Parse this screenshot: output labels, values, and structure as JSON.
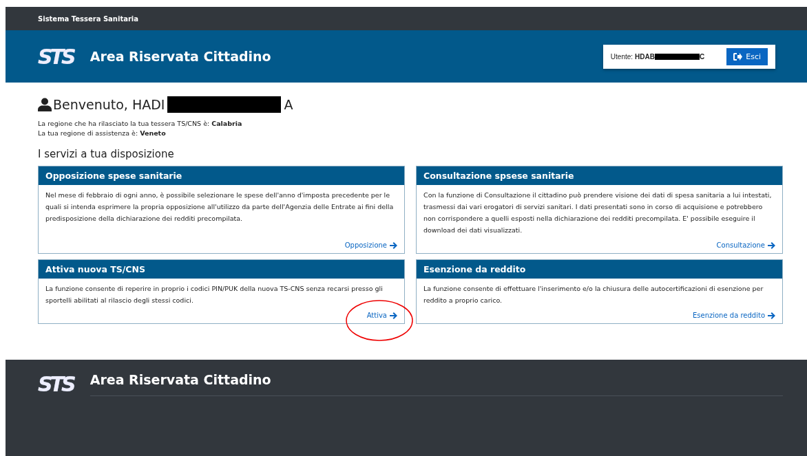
{
  "top_bar": {
    "title": "Sistema Tessera Sanitaria"
  },
  "header": {
    "logo": "STS",
    "title": "Area Riservata Cittadino",
    "user_label": "Utente:",
    "user_code_start": "HDAB",
    "user_code_end": "C",
    "logout": "Esci"
  },
  "welcome": {
    "greeting": "Benvenuto, HADI",
    "name_end": "A",
    "lines": [
      "La regione che ha rilasciato la tua tessera TS/CNS è:  **Calabria**",
      "La tua regione di assistenza è:  **Veneto**"
    ]
  },
  "services": {
    "title": "I servizi a tua disposizione",
    "cards": [
      {
        "title": "Opposizione spese sanitarie",
        "text": "Nel mese di febbraio di ogni anno, è possibile selezionare le spese dell'anno d'imposta precedente per le quali si intenda esprimere la propria opposizione all'utilizzo da parte dell'Agenzia delle Entrate ai fini della predisposizione della dichiarazione dei redditi precompilata.",
        "link": "Opposizione",
        "circled": false
      },
      {
        "title": "Consultazione spsese sanitarie",
        "text": "Con la funzione di Consultazione il cittadino può prendere visione dei dati di spesa sanitaria a lui intestati, trasmessi dai vari erogatori di servizi sanitari. I dati presentati sono in corso di acquisione e potrebbero non corrispondere a quelli esposti nella dichiarazione dei redditi precompilata. E' possibile eseguire il download dei dati visualizzati.",
        "link": "Consultazione",
        "circled": false
      },
      {
        "title": "Attiva nuova TS/CNS",
        "text": "La funzione consente di reperire in proprio i codici PIN/PUK della nuova TS-CNS senza recarsi presso gli sportelli abilitati al rilascio degli stessi codici.",
        "link": "Attiva",
        "circled": true
      },
      {
        "title": "Esenzione da reddito",
        "text": "La funzione consente di effettuare l'inserimento e/o la chiusura delle autocertificazioni di esenzione per reddito a proprio carico.",
        "link": "Esenzione da reddito",
        "circled": false
      }
    ]
  },
  "footer": {
    "logo": "STS",
    "title": "Area Riservata Cittadino"
  }
}
